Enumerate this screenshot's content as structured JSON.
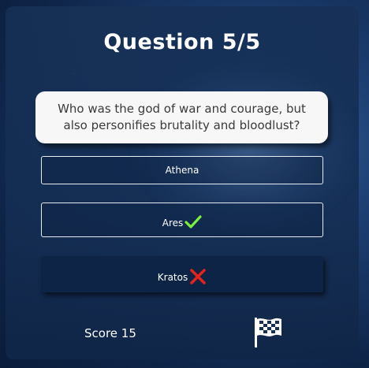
{
  "quiz": {
    "title": "Question 5/5",
    "question": "Who was the god of war and courage, but also personifies brutality and bloodlust?",
    "answers": [
      {
        "label": "Athena",
        "status": "neutral"
      },
      {
        "label": "Ares",
        "status": "correct",
        "icon": "check-icon"
      },
      {
        "label": "Kratos",
        "status": "wrong",
        "icon": "cross-icon"
      }
    ],
    "score_text": "Score 15",
    "finish_icon": "checkered-flag-icon"
  },
  "colors": {
    "correct": "#7cf03b",
    "wrong": "#e3231c",
    "question_bg": "#f7f7f7",
    "card_bg": "#163056"
  }
}
